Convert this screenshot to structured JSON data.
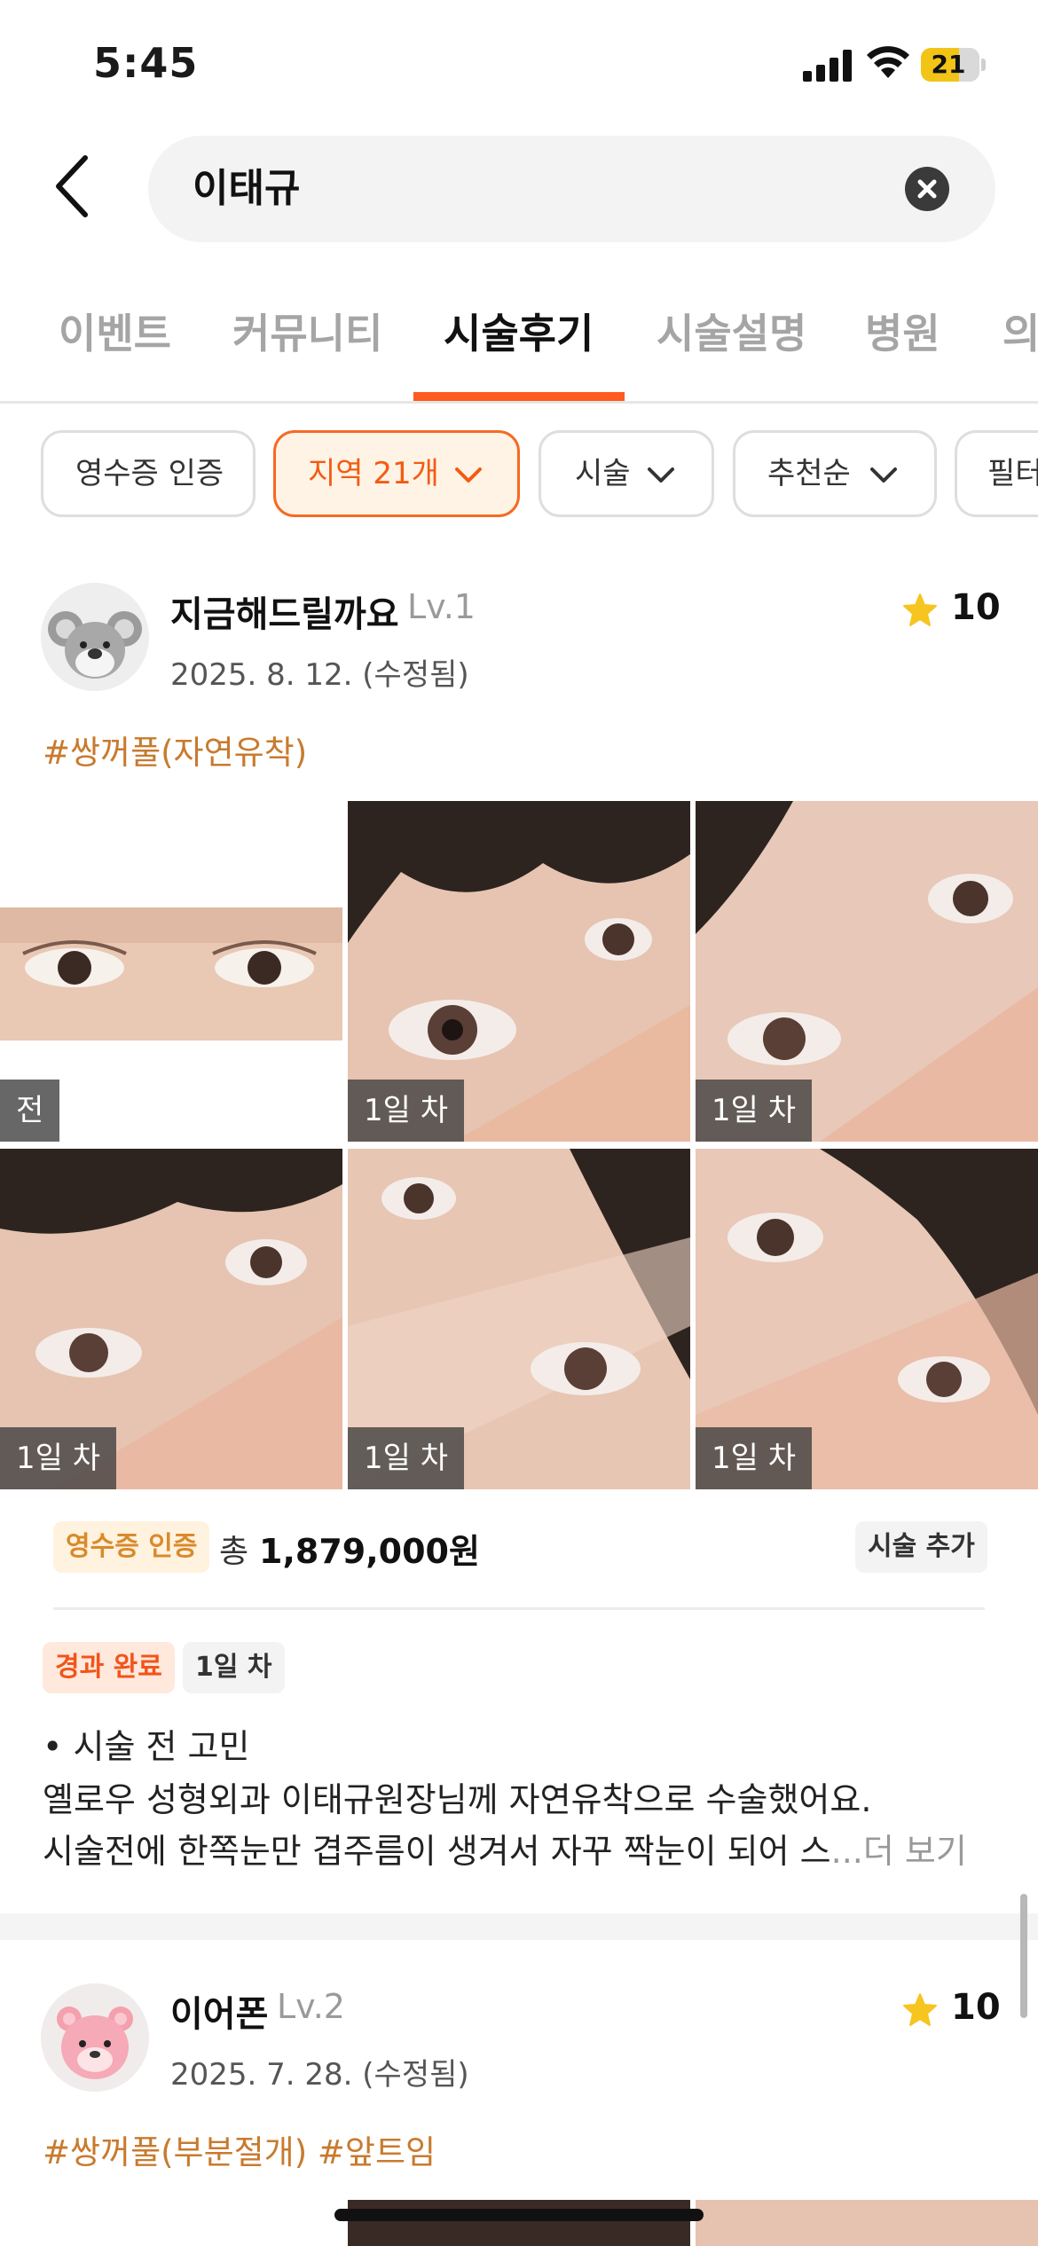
{
  "status_bar": {
    "time": "5:45",
    "battery_level": "21",
    "battery_fraction": 0.21
  },
  "search": {
    "query": "이태규"
  },
  "tabs": [
    {
      "label": "이벤트",
      "active": false
    },
    {
      "label": "커뮤니티",
      "active": false
    },
    {
      "label": "시술후기",
      "active": true
    },
    {
      "label": "시술설명",
      "active": false
    },
    {
      "label": "병원",
      "active": false
    },
    {
      "label": "의",
      "active": false
    }
  ],
  "filters": [
    {
      "label": "영수증 인증",
      "active": false
    },
    {
      "label": "지역 21개",
      "active": true
    },
    {
      "label": "시술",
      "active": false
    },
    {
      "label": "추천순",
      "active": false
    },
    {
      "label": "필터",
      "active": false
    }
  ],
  "colors": {
    "accent": "#ff5a1f",
    "tag": "#c87a2e",
    "star": "#f7c51f"
  },
  "posts": [
    {
      "username": "지금해드릴까요",
      "level": "Lv.1",
      "date": "2025. 8. 12. (수정됨)",
      "score": "10",
      "avatar_icon": "koala-avatar-icon",
      "tags": "#쌍꺼풀(자연유착)",
      "photos": [
        {
          "label": "전"
        },
        {
          "label": "1일 차"
        },
        {
          "label": "1일 차"
        },
        {
          "label": "1일 차"
        },
        {
          "label": "1일 차"
        },
        {
          "label": "1일 차"
        }
      ],
      "receipt_badge": "영수증 인증",
      "total_label": "총",
      "total_price": "1,879,000원",
      "add_procedure": "시술 추가",
      "status_badge": "경과 완료",
      "day_badge": "1일 차",
      "body_heading": "• 시술 전 고민",
      "body_line1": "옐로우 성형외과 이태규원장님께 자연유착으로 수술했어요.",
      "body_line2": "시술전에 한쪽눈만 겹주름이 생겨서 자꾸 짝눈이 되어 스",
      "more": "...더 보기"
    },
    {
      "username": "이어폰",
      "level": "Lv.2",
      "date": "2025. 7. 28. (수정됨)",
      "score": "10",
      "avatar_icon": "bear-avatar-icon",
      "tags": "#쌍꺼풀(부분절개) #앞트임"
    }
  ]
}
